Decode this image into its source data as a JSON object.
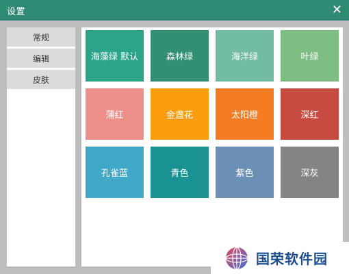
{
  "window": {
    "title": "设置",
    "close_icon": "close-icon",
    "header_color": "#2f8a73"
  },
  "sidebar": {
    "items": [
      {
        "label": "常规"
      },
      {
        "label": "编辑"
      },
      {
        "label": "皮肤"
      }
    ]
  },
  "skins": [
    {
      "label": "海藻绿 默认",
      "color": "#2aa58a"
    },
    {
      "label": "森林绿",
      "color": "#338f73"
    },
    {
      "label": "海洋绿",
      "color": "#72bca4"
    },
    {
      "label": "叶绿",
      "color": "#7fbe82"
    },
    {
      "label": "蒲红",
      "color": "#ee8f8a"
    },
    {
      "label": "金盏花",
      "color": "#fa9e0f"
    },
    {
      "label": "太阳橙",
      "color": "#f47c22"
    },
    {
      "label": "深红",
      "color": "#c84b42"
    },
    {
      "label": "孔雀蓝",
      "color": "#41a8c7"
    },
    {
      "label": "青色",
      "color": "#1a9292"
    },
    {
      "label": "紫色",
      "color": "#6c8fb6"
    },
    {
      "label": "深灰",
      "color": "#828485"
    }
  ],
  "watermark": {
    "text": "国荣软件园",
    "logo_icon": "globe-logo-icon"
  }
}
